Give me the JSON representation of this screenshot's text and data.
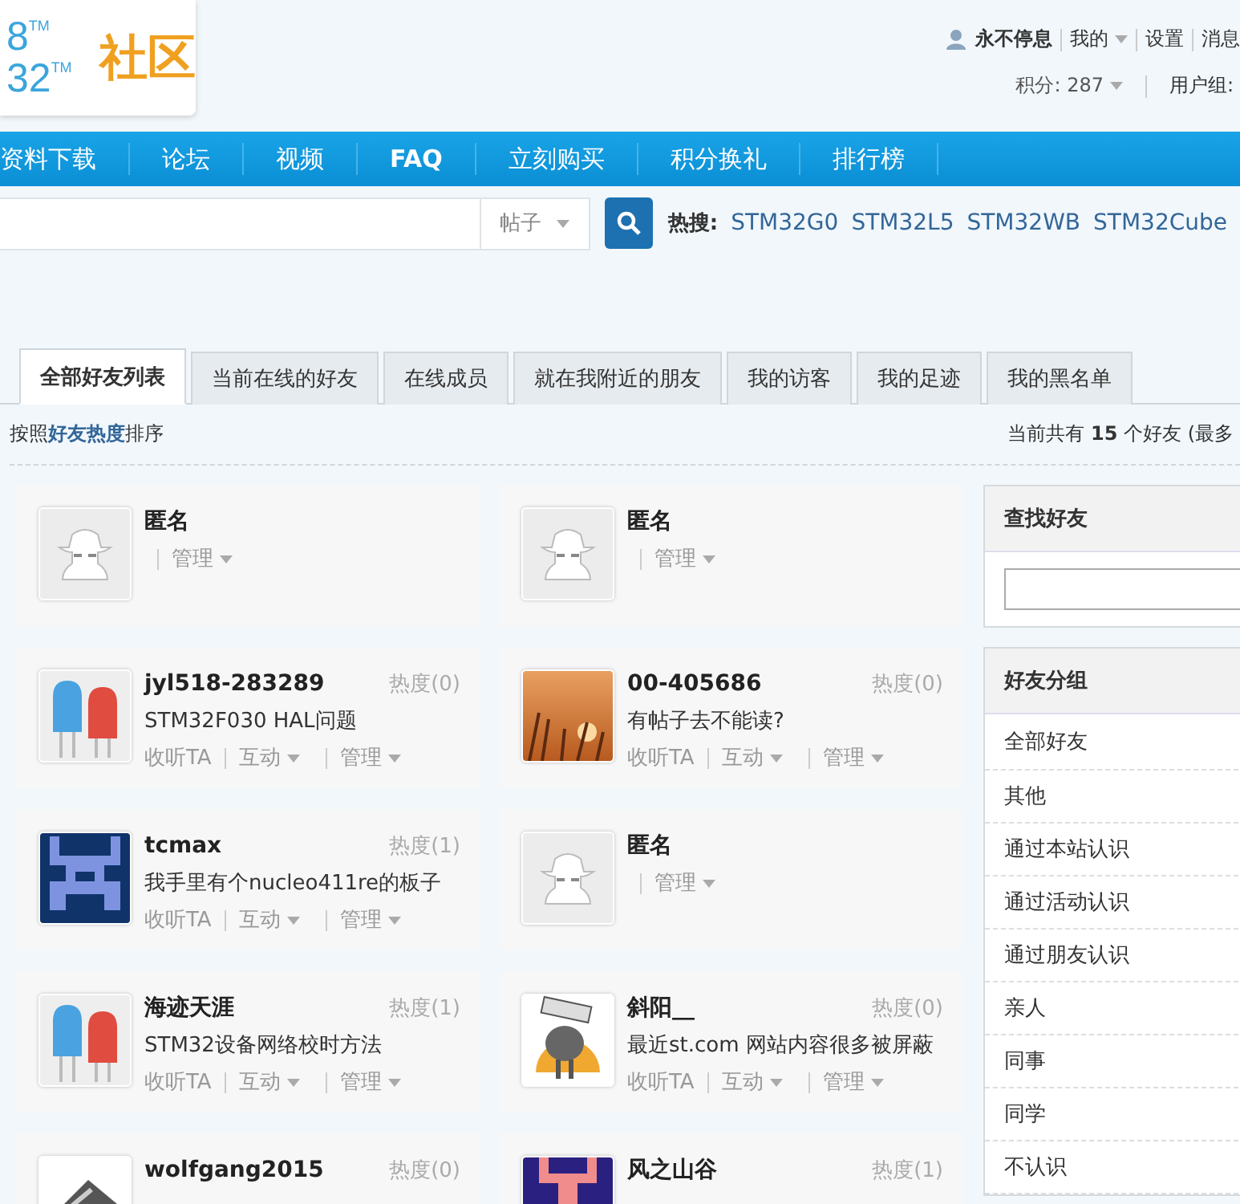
{
  "logo": {
    "lines": [
      {
        "digits": "8",
        "mark": "TM"
      },
      {
        "digits": "32",
        "mark": "TM"
      }
    ],
    "text": "社区"
  },
  "user_bar": {
    "username": "永不停息",
    "links": [
      {
        "label": "我的",
        "dropdown": true
      },
      {
        "label": "设置",
        "dropdown": false
      },
      {
        "label": "消息",
        "dropdown": false
      }
    ],
    "points": "积分: 287",
    "user_group": "用户组:"
  },
  "nav": [
    "资料下载",
    "论坛",
    "视频",
    "FAQ",
    "立刻购买",
    "积分换礼",
    "排行榜"
  ],
  "search": {
    "scope": "帖子",
    "hot_label": "热搜:",
    "hot_links": [
      "STM32G0",
      "STM32L5",
      "STM32WB",
      "STM32Cube"
    ]
  },
  "tabs": [
    {
      "label": "全部好友列表",
      "selected": true
    },
    {
      "label": "当前在线的好友",
      "selected": false
    },
    {
      "label": "在线成员",
      "selected": false
    },
    {
      "label": "就在我附近的朋友",
      "selected": false
    },
    {
      "label": "我的访客",
      "selected": false
    },
    {
      "label": "我的足迹",
      "selected": false
    },
    {
      "label": "我的黑名单",
      "selected": false
    }
  ],
  "sort": {
    "prefix": "按照",
    "link": "好友热度",
    "suffix": "排序"
  },
  "count": "当前共有 **15** 个好友 (最多",
  "friends": [
    {
      "name": "匿名",
      "kind": "anon",
      "actions": [
        {
          "label": "管理",
          "kind": "menu"
        }
      ]
    },
    {
      "name": "匿名",
      "kind": "anon",
      "actions": [
        {
          "label": "管理",
          "kind": "menu"
        }
      ]
    },
    {
      "name": "jyl518-283289",
      "kind": "led",
      "heat": "热度(0)",
      "status": "STM32F030 HAL问题",
      "actions": [
        {
          "label": "收听TA",
          "kind": "follow"
        },
        {
          "label": "互动",
          "kind": "menu"
        },
        {
          "label": "管理",
          "kind": "menu"
        }
      ]
    },
    {
      "name": "00-405686",
      "kind": "photo",
      "heat": "热度(0)",
      "status": "有帖子去不能读?",
      "actions": [
        {
          "label": "收听TA",
          "kind": "follow"
        },
        {
          "label": "互动",
          "kind": "menu"
        },
        {
          "label": "管理",
          "kind": "menu"
        }
      ]
    },
    {
      "name": "tcmax",
      "kind": "pixel",
      "heat": "热度(1)",
      "status": "我手里有个nucleo411re的板子",
      "actions": [
        {
          "label": "收听TA",
          "kind": "follow"
        },
        {
          "label": "互动",
          "kind": "menu"
        },
        {
          "label": "管理",
          "kind": "menu"
        }
      ]
    },
    {
      "name": "匿名",
      "kind": "anon",
      "actions": [
        {
          "label": "管理",
          "kind": "menu"
        }
      ]
    },
    {
      "name": "海迹天涯",
      "kind": "led",
      "heat": "热度(1)",
      "status": "STM32设备网络校时方法",
      "actions": [
        {
          "label": "收听TA",
          "kind": "follow"
        },
        {
          "label": "互动",
          "kind": "menu"
        },
        {
          "label": "管理",
          "kind": "menu"
        }
      ]
    },
    {
      "name": "斜阳__",
      "kind": "cartoon",
      "heat": "热度(0)",
      "status": "最近st.com 网站内容很多被屏蔽",
      "actions": [
        {
          "label": "收听TA",
          "kind": "follow"
        },
        {
          "label": "互动",
          "kind": "menu"
        },
        {
          "label": "管理",
          "kind": "menu"
        }
      ]
    },
    {
      "name": "wolfgang2015",
      "kind": "chip",
      "heat": "热度(0)"
    },
    {
      "name": "风之山谷",
      "kind": "pixel2",
      "heat": "热度(1)"
    }
  ],
  "sidebar": {
    "find_title": "查找好友",
    "groups_title": "好友分组",
    "groups": [
      "全部好友",
      "其他",
      "通过本站认识",
      "通过活动认识",
      "通过朋友认识",
      "亲人",
      "同事",
      "同学",
      "不认识"
    ]
  }
}
